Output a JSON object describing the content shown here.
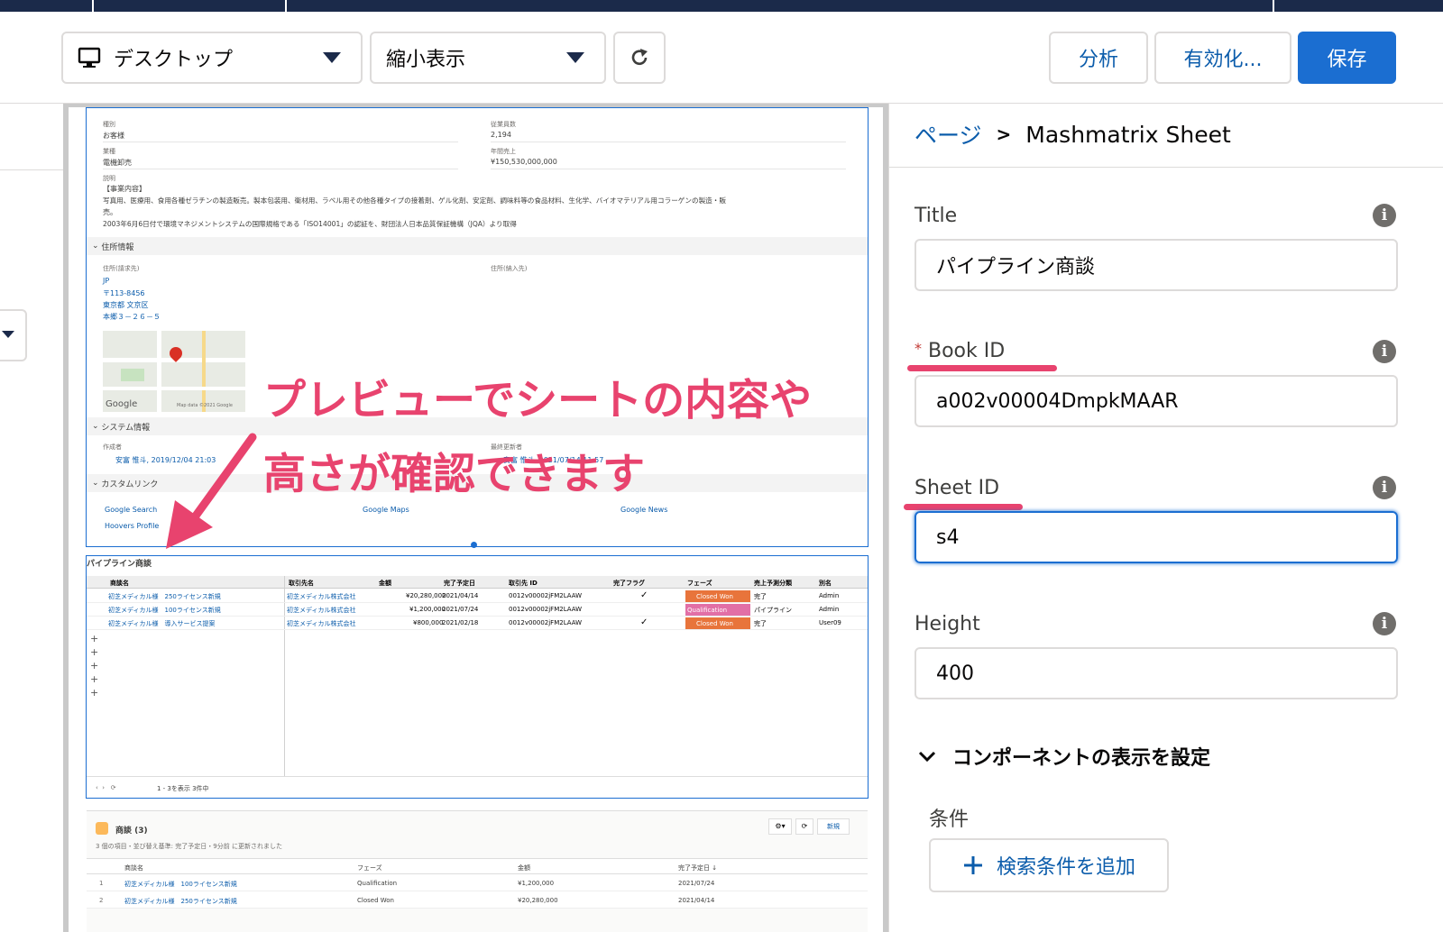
{
  "toolbar": {
    "device_select": "デスクトップ",
    "zoom_select": "縮小表示",
    "analyze_label": "分析",
    "activate_label": "有効化...",
    "save_label": "保存"
  },
  "preview": {
    "account": {
      "type_label": "種別",
      "type_value": "お客様",
      "employees_label": "従業員数",
      "employees_value": "2,194",
      "industry_label": "業種",
      "industry_value": "電機卸売",
      "revenue_label": "年間売上",
      "revenue_value": "¥150,530,000,000",
      "desc_label": "説明",
      "desc_line1": "【事業内容】",
      "desc_line2": "写真用、医療用、食用各種ゼラチンの製造販売。製本包装用、衛材用、ラベル用その他各種タイプの接着剤、ゲル化剤、安定剤、調味料等の食品材料、生化学、バイオマテリアル用コラーゲンの製造・販",
      "desc_line3": "売。",
      "desc_line4": "2003年6月6日付で環境マネジメントシステムの国際規格である「ISO14001」の認証を、財団法人日本品質保証機構（JQA）より取得"
    },
    "address": {
      "section": "住所情報",
      "billing_label": "住所(請求先)",
      "shipping_label": "住所(納入先)",
      "lines": [
        "JP",
        "〒113-8456",
        "東京都 文京区",
        "本郷３－２６－５"
      ],
      "map_google": "Google",
      "map_data": "Map data ©2021 Google"
    },
    "system": {
      "section": "システム情報",
      "created_label": "作成者",
      "created_value": "安富 惟斗, 2019/12/04 21:03",
      "modified_label": "最終更新者",
      "modified_value": "安富 惟斗, 2021/07/14 11:57"
    },
    "custom_links": {
      "section": "カスタムリンク",
      "items": [
        "Google Search",
        "Google Maps",
        "Google News",
        "Hoovers Profile"
      ]
    },
    "pipeline": {
      "title": "パイプライン商談",
      "headers": [
        "商談名",
        "取引先名",
        "金額",
        "完了予定日",
        "取引先 ID",
        "完了フラグ",
        "フェーズ",
        "売上予測分類",
        "別名"
      ],
      "rows": [
        [
          "初芝メディカル様　250ライセンス新規",
          "初芝メディカル株式会社",
          "¥20,280,000",
          "2021/04/14",
          "0012v00002jFM2LAAW",
          "✓",
          "Closed Won",
          "完了",
          "Admin"
        ],
        [
          "初芝メディカル様　100ライセンス新規",
          "初芝メディカル株式会社",
          "¥1,200,000",
          "2021/07/24",
          "0012v00002jFM2LAAW",
          "",
          "Qualification",
          "パイプライン",
          "Admin"
        ],
        [
          "初芝メディカル様　導入サービス提案",
          "初芝メディカル株式会社",
          "¥800,000",
          "2021/02/18",
          "0012v00002jFM2LAAW",
          "✓",
          "Closed Won",
          "完了",
          "User09"
        ]
      ],
      "footer": "1 - 3を表示 3件中"
    },
    "related": {
      "title": "商談 (3)",
      "subtitle": "3 個の項目・並び替え基準: 完了予定日・9分前 に更新されました",
      "new_label": "新規",
      "headers": [
        "商談名",
        "フェーズ",
        "金額",
        "完了予定日 ↓"
      ],
      "rows": [
        [
          "1",
          "初芝メディカル様　100ライセンス新規",
          "Qualification",
          "¥1,200,000",
          "2021/07/24"
        ],
        [
          "2",
          "初芝メディカル様　250ライセンス新規",
          "Closed Won",
          "¥20,280,000",
          "2021/04/14"
        ]
      ]
    }
  },
  "annotation": {
    "line1": "プレビューでシートの内容や",
    "line2": "高さが確認できます"
  },
  "panel": {
    "breadcrumb_root": "ページ",
    "breadcrumb_sep": ">",
    "breadcrumb_current": "Mashmatrix Sheet",
    "title_label": "Title",
    "title_value": "パイプライン商談",
    "bookid_required": "*",
    "bookid_label": "Book ID",
    "bookid_value": "a002v00004DmpkMAAR",
    "sheetid_label": "Sheet ID",
    "sheetid_value": "s4",
    "height_label": "Height",
    "height_value": "400",
    "visibility_section": "コンポーネントの表示を設定",
    "condition_label": "条件",
    "add_condition_label": "検索条件を追加"
  },
  "colors": {
    "accent": "#1b6ed1",
    "annotation": "#e8436e",
    "closed_won": "#e8743b",
    "qualification": "#e26fa6",
    "navbar": "#1b2a4a"
  }
}
